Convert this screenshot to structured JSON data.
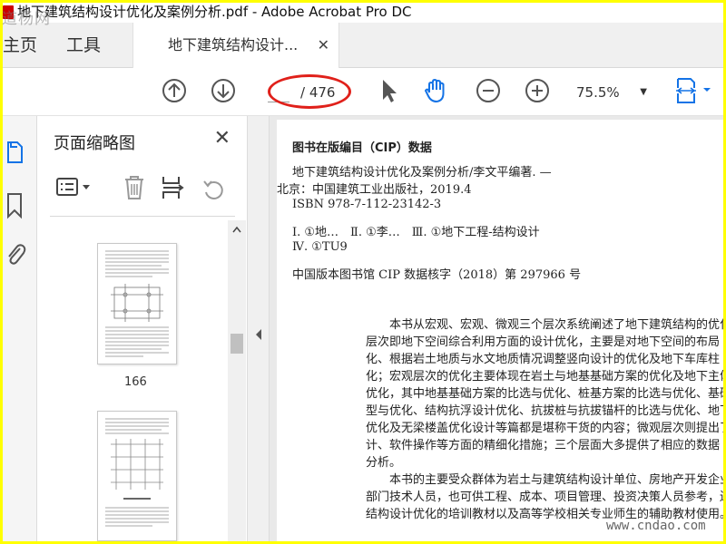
{
  "window": {
    "title": "地下建筑结构设计优化及案例分析.pdf - Adobe Acrobat Pro DC",
    "watermark_top": "道杨网",
    "watermark_bottom": "www.cndao.com"
  },
  "tabs": {
    "home": "主页",
    "tools": "工具",
    "document": "地下建筑结构设计...",
    "close": "✕"
  },
  "toolbar": {
    "page_total": "/ 476",
    "zoom": "75.5%"
  },
  "thumbnail_panel": {
    "title": "页面缩略图",
    "close": "✕",
    "page_label": "166"
  },
  "document": {
    "cip_heading": "图书在版编目（CIP）数据",
    "cip_lines": [
      "地下建筑结构设计优化及案例分析/李文平编著. —",
      "北京：中国建筑工业出版社，2019.4",
      "ISBN 978-7-112-23142-3",
      "Ⅰ. ①地…　Ⅱ. ①李…　Ⅲ. ①地下工程-结构设计",
      "Ⅳ. ①TU9",
      "中国版本图书馆 CIP 数据核字（2018）第 297966 号"
    ],
    "paragraph": [
      "本书从宏观、宏观、微观三个层次系统阐述了地下建筑结构的优化",
      "层次即地下空间综合利用方面的设计优化，主要是对地下空间的布局",
      "化、根据岩土地质与水文地质情况调整竖向设计的优化及地下车库柱",
      "化；宏观层次的优化主要体现在岩土与地基基础方案的优化及地下主体",
      "优化，其中地基基础方案的比选与优化、桩基方案的比选与优化、基础",
      "型与优化、结构抗浮设计优化、抗拔桩与抗拔锚杆的比选与优化、地下",
      "优化及无梁楼盖优化设计等篇都是堪称干货的内容；微观层次则提出了",
      "计、软件操作等方面的精细化措施；三个层面大多提供了相应的数据",
      "分析。",
      "本书的主要受众群体为岩土与建筑结构设计单位、房地产开发企业",
      "部门技术人员，也可供工程、成本、项目管理、投资决策人员参考，还",
      "结构设计优化的培训教材以及高等学校相关专业师生的辅助教材使用。"
    ]
  }
}
